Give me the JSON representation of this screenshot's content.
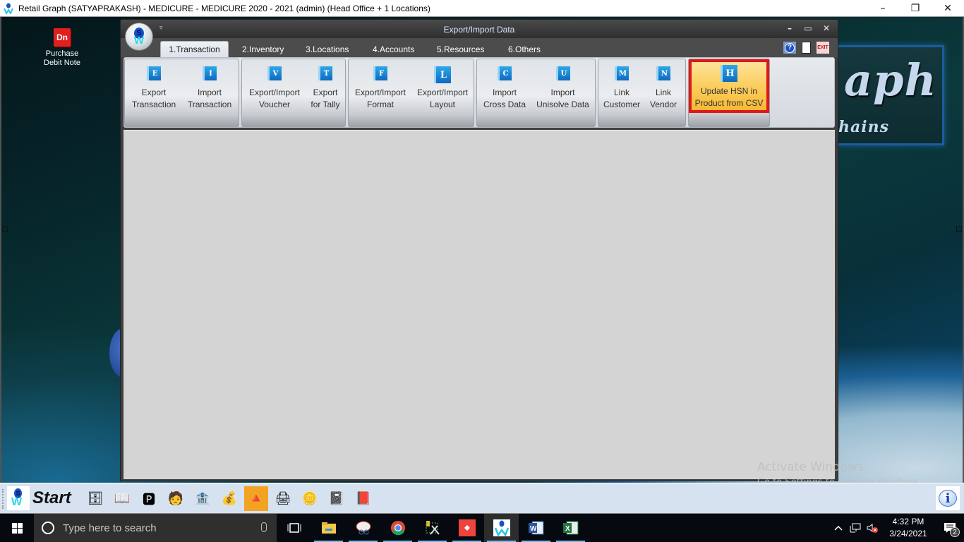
{
  "app": {
    "title": "Retail Graph (SATYAPRAKASH) - MEDICURE - MEDICURE  2020 - 2021 (admin) (Head Office + 1 Locations)",
    "controls": {
      "minimize": "–",
      "restore": "❐",
      "close": "✕"
    }
  },
  "desktop": {
    "icons": [
      {
        "label_line1": "Purchase",
        "label_line2": "Debit Note",
        "glyph": "Dn",
        "icon": "debit-note-icon"
      }
    ],
    "brand": {
      "big": "aph",
      "small": "hains"
    }
  },
  "window": {
    "title": "Export/Import Data",
    "qat_glyph": "▿",
    "controls": {
      "minimize": "–",
      "maximize": "▭",
      "close": "✕"
    },
    "orb": {
      "s": "S",
      "w": "W"
    },
    "tabs": [
      {
        "label": "1.Transaction",
        "active": true
      },
      {
        "label": "2.Inventory",
        "active": false
      },
      {
        "label": "3.Locations",
        "active": false
      },
      {
        "label": "4.Accounts",
        "active": false
      },
      {
        "label": "5.Resources",
        "active": false
      },
      {
        "label": "6.Others",
        "active": false
      }
    ],
    "tools": {
      "help": "?",
      "exit": "EXIT"
    },
    "ribbon_groups": [
      {
        "buttons": [
          {
            "line1": "Export",
            "line2": "Transaction",
            "glyph": "E"
          },
          {
            "line1": "Import",
            "line2": "Transaction",
            "glyph": "I"
          }
        ]
      },
      {
        "buttons": [
          {
            "line1": "Export/Import",
            "line2": "Voucher",
            "glyph": "V"
          },
          {
            "line1": "Export",
            "line2": "for Tally",
            "glyph": "T"
          }
        ]
      },
      {
        "buttons": [
          {
            "line1": "Export/Import",
            "line2": "Format",
            "glyph": "F"
          },
          {
            "line1": "Export/Import",
            "line2": "Layout",
            "glyph": "L"
          }
        ]
      },
      {
        "buttons": [
          {
            "line1": "Import",
            "line2": "Cross Data",
            "glyph": "C"
          },
          {
            "line1": "Import",
            "line2": "Unisolve Data",
            "glyph": "U"
          }
        ]
      },
      {
        "buttons": [
          {
            "line1": "Link",
            "line2": "Customer",
            "glyph": "M"
          },
          {
            "line1": "Link",
            "line2": "Vendor",
            "glyph": "N"
          }
        ]
      },
      {
        "buttons": [
          {
            "line1": "Update HSN in",
            "line2": "Product from CSV",
            "glyph": "H",
            "highlighted": true
          }
        ]
      }
    ]
  },
  "watermark": {
    "line1": "Activate Windows",
    "line2": "Go to Settings to activate Windows."
  },
  "quickbar": {
    "start_label": "Start",
    "logo": {
      "s": "S",
      "w": "W"
    },
    "icons": [
      {
        "name": "purchase-icon",
        "glyph": "🗄"
      },
      {
        "name": "order-book-icon",
        "glyph": "📖"
      },
      {
        "name": "purchase-register-icon",
        "glyph": "🅿"
      },
      {
        "name": "cashier-icon",
        "glyph": "🧑"
      },
      {
        "name": "transfer-icon",
        "glyph": "🏦"
      },
      {
        "name": "money-calculator-icon",
        "glyph": "💰"
      },
      {
        "name": "shapes-icon",
        "glyph": "🔺",
        "selected": true
      },
      {
        "name": "printer-icon",
        "glyph": "🖨"
      },
      {
        "name": "gold-coins-icon",
        "glyph": "🪙"
      },
      {
        "name": "sales-invoice-icon",
        "glyph": "📓"
      },
      {
        "name": "purchase-invoice-icon",
        "glyph": "📕"
      }
    ],
    "info": "i"
  },
  "taskbar": {
    "search_placeholder": "Type here to search",
    "apps": [
      {
        "name": "task-view-icon",
        "glyph": "⧠",
        "running": false
      },
      {
        "name": "file-explorer-icon",
        "glyph": "📁",
        "running": true
      },
      {
        "name": "snipping-tool-icon",
        "glyph": "✂",
        "running": true
      },
      {
        "name": "chrome-icon",
        "glyph": "◉",
        "running": true
      },
      {
        "name": "tools-icon",
        "glyph": "⚒",
        "running": true
      },
      {
        "name": "anydesk-icon",
        "glyph": "◆",
        "running": true
      },
      {
        "name": "retail-graph-icon",
        "glyph": "W",
        "running": true,
        "active": true
      },
      {
        "name": "word-icon",
        "glyph": "W",
        "running": true
      },
      {
        "name": "excel-icon",
        "glyph": "X",
        "running": true
      }
    ],
    "tray": {
      "chevron": "^",
      "network": "🖳",
      "volume": "🔇"
    },
    "time": "4:32 PM",
    "date": "3/24/2021",
    "notifications": "2"
  }
}
